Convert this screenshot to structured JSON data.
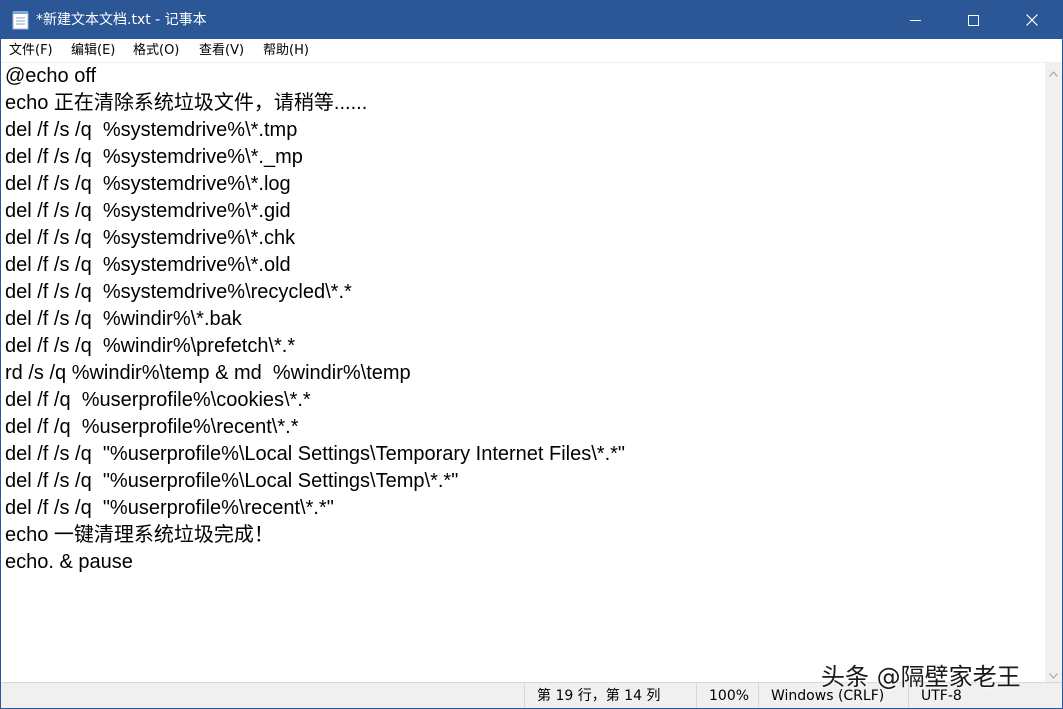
{
  "window": {
    "title": "*新建文本文档.txt - 记事本",
    "title_bar_color": "#2b5797"
  },
  "icons": {
    "app": "notepad-icon",
    "minimize": "minimize-icon",
    "maximize": "maximize-icon",
    "close": "close-icon",
    "scroll_up": "scroll-up-arrow-icon",
    "scroll_down": "scroll-down-arrow-icon"
  },
  "menu": {
    "items": [
      {
        "label": "文件(F)"
      },
      {
        "label": "编辑(E)"
      },
      {
        "label": "格式(O)"
      },
      {
        "label": "查看(V)"
      },
      {
        "label": "帮助(H)"
      }
    ]
  },
  "editor": {
    "lines": [
      "@echo off",
      "echo 正在清除系统垃圾文件，请稍等......",
      "del /f /s /q  %systemdrive%\\*.tmp",
      "del /f /s /q  %systemdrive%\\*._mp",
      "del /f /s /q  %systemdrive%\\*.log",
      "del /f /s /q  %systemdrive%\\*.gid",
      "del /f /s /q  %systemdrive%\\*.chk",
      "del /f /s /q  %systemdrive%\\*.old",
      "del /f /s /q  %systemdrive%\\recycled\\*.*",
      "del /f /s /q  %windir%\\*.bak",
      "del /f /s /q  %windir%\\prefetch\\*.*",
      "rd /s /q %windir%\\temp & md  %windir%\\temp",
      "del /f /q  %userprofile%\\cookies\\*.*",
      "del /f /q  %userprofile%\\recent\\*.*",
      "del /f /s /q  \"%userprofile%\\Local Settings\\Temporary Internet Files\\*.*\"",
      "del /f /s /q  \"%userprofile%\\Local Settings\\Temp\\*.*\"",
      "del /f /s /q  \"%userprofile%\\recent\\*.*\"",
      "echo 一键清理系统垃圾完成！",
      "echo. & pause"
    ]
  },
  "statusbar": {
    "position": "第 19 行，第 14 列",
    "zoom": "100%",
    "line_ending": "Windows (CRLF)",
    "encoding": "UTF-8"
  },
  "watermark": {
    "text": "头条 @隔壁家老王"
  }
}
